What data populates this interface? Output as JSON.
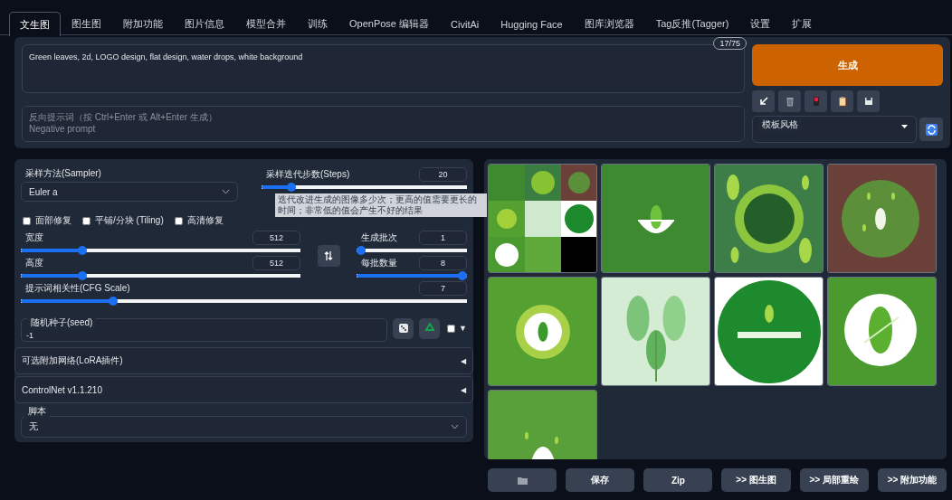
{
  "tabs": [
    {
      "label": "文生图",
      "selected": true
    },
    {
      "label": "图生图",
      "selected": false
    },
    {
      "label": "附加功能",
      "selected": false
    },
    {
      "label": "图片信息",
      "selected": false
    },
    {
      "label": "模型合并",
      "selected": false
    },
    {
      "label": "训练",
      "selected": false
    },
    {
      "label": "OpenPose 编辑器",
      "selected": false
    },
    {
      "label": "CivitAi",
      "selected": false
    },
    {
      "label": "Hugging Face",
      "selected": false
    },
    {
      "label": "图库浏览器",
      "selected": false
    },
    {
      "label": "Tag反推(Tagger)",
      "selected": false
    },
    {
      "label": "设置",
      "selected": false
    },
    {
      "label": "扩展",
      "selected": false
    }
  ],
  "prompt": {
    "value": "Green leaves, 2d, LOGO design, flat design, water drops, white background",
    "token_count": "17/75"
  },
  "negative_prompt": {
    "placeholder": "反向提示词（按 Ctrl+Enter 或 Alt+Enter 生成）\nNegative prompt"
  },
  "generate_button": "生成",
  "tool_buttons": [
    {
      "kind": "arrow"
    },
    {
      "kind": "trash"
    },
    {
      "kind": "stamp"
    },
    {
      "kind": "clipboard"
    },
    {
      "kind": "save"
    }
  ],
  "styles": {
    "label": "模板风格"
  },
  "sampler": {
    "label": "采样方法(Sampler)",
    "value": "Euler a"
  },
  "steps": {
    "label": "采样迭代步数(Steps)",
    "value": "20",
    "level": 0.13,
    "tooltip": "迭代改进生成的图像多少次；更高的值需要更长的时间；非常低的值会产生不好的结果"
  },
  "options": [
    {
      "label": "面部修复",
      "checked": false
    },
    {
      "label": "平铺/分块 (Tiling)",
      "checked": false
    },
    {
      "label": "高清修复",
      "checked": false
    }
  ],
  "width": {
    "label": "宽度",
    "value": "512",
    "level": 0.21
  },
  "height": {
    "label": "高度",
    "value": "512",
    "level": 0.21
  },
  "batch_count": {
    "label": "生成批次",
    "value": "1",
    "level": 0
  },
  "batch_size": {
    "label": "每批数量",
    "value": "8",
    "level": 1
  },
  "cfg_scale": {
    "label": "提示词相关性(CFG Scale)",
    "value": "7",
    "level": 0.2
  },
  "seed": {
    "label": "随机种子(seed)",
    "value": "-1",
    "extra_checked": false,
    "extra_arrow": "▼"
  },
  "accordions": [
    {
      "title": "可选附加网络(LoRA插件)",
      "expanded": false,
      "arrow": "◀"
    },
    {
      "title": "ControlNet v1.1.210",
      "expanded": false,
      "arrow": "◀"
    }
  ],
  "script": {
    "label": "脚本",
    "value": "无"
  },
  "actions": [
    {
      "kind": "folder"
    },
    {
      "kind": "text",
      "label": "保存"
    },
    {
      "kind": "text",
      "label": "Zip"
    },
    {
      "kind": "text",
      "label": ">> 图生图"
    },
    {
      "kind": "text",
      "label": ">> 局部重绘"
    },
    {
      "kind": "text",
      "label": ">> 附加功能"
    }
  ]
}
